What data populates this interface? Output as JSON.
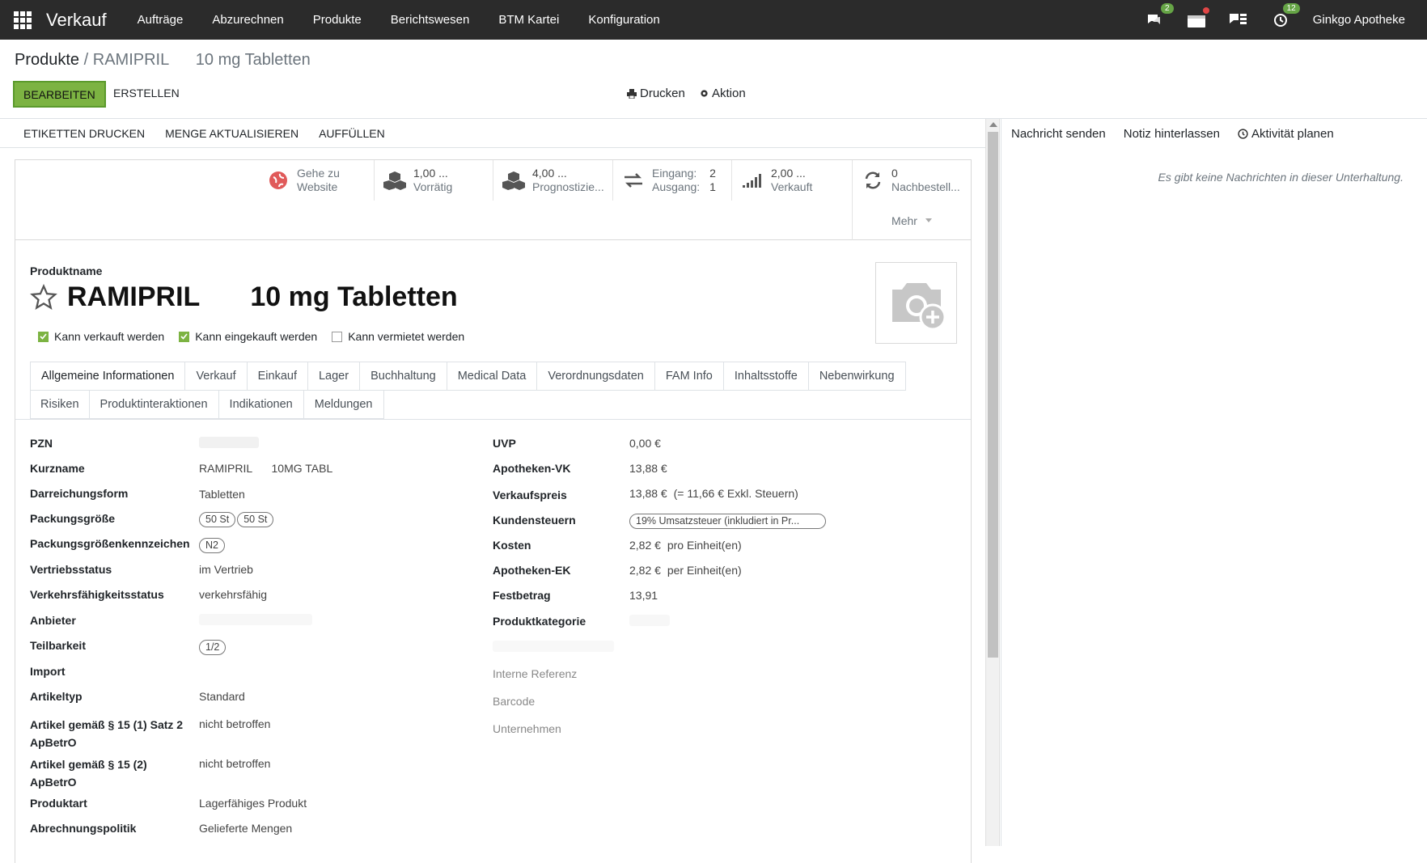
{
  "nav": {
    "app_name": "Verkauf",
    "menu": [
      "Aufträge",
      "Abzurechnen",
      "Produkte",
      "Berichtswesen",
      "BTM Kartei",
      "Konfiguration"
    ],
    "messages_badge": "2",
    "activities_badge": "12",
    "company": "Ginkgo Apotheke",
    "badge_color": "#66a546"
  },
  "breadcrumb": {
    "parent": "Produkte",
    "separator": "/",
    "current": "RAMIPRIL      10 mg Tabletten"
  },
  "controls": {
    "edit": "BEARBEITEN",
    "create": "ERSTELLEN",
    "print": "Drucken",
    "action": "Aktion"
  },
  "statusbar": [
    "ETIKETTEN DRUCKEN",
    "MENGE AKTUALISIEREN",
    "AUFFÜLLEN"
  ],
  "smart_buttons": {
    "website": {
      "line1": "Gehe zu",
      "line2": "Website"
    },
    "onhand": {
      "value": "1,00 ...",
      "label": "Vorrätig"
    },
    "forecast": {
      "value": "4,00 ...",
      "label": "Prognostizie..."
    },
    "moves": {
      "in_label": "Eingang:",
      "in_value": "2",
      "out_label": "Ausgang:",
      "out_value": "1"
    },
    "sold": {
      "value": "2,00 ...",
      "label": "Verkauft"
    },
    "reorder": {
      "value": "0",
      "label": "Nachbestell..."
    },
    "more": "Mehr"
  },
  "product": {
    "name_label": "Produktname",
    "name": "RAMIPRIL",
    "name_suffix": "10 mg Tabletten",
    "can_sell": "Kann verkauft werden",
    "can_purchase": "Kann eingekauft werden",
    "can_rent": "Kann vermietet werden"
  },
  "tabs_row1": [
    "Allgemeine Informationen",
    "Verkauf",
    "Einkauf",
    "Lager",
    "Buchhaltung",
    "Medical Data",
    "Verordnungsdaten",
    "FAM Info",
    "Inhaltsstoffe",
    "Nebenwirkung"
  ],
  "tabs_row2": [
    "Risiken",
    "Produktinteraktionen",
    "Indikationen",
    "Meldungen"
  ],
  "left_fields": {
    "pzn": "PZN",
    "kurzname": "Kurzname",
    "kurzname_val1": "RAMIPRIL",
    "kurzname_val2": "10MG TABL",
    "darreichungsform": "Darreichungsform",
    "darreichungsform_val": "Tabletten",
    "packungsgroesse": "Packungsgröße",
    "packungsgroesse_tag1": "50 St",
    "packungsgroesse_tag2": "50 St",
    "kennzeichen": "Packungsgrößenkennzeichen",
    "kennzeichen_tag": "N2",
    "vertriebsstatus": "Vertriebsstatus",
    "vertriebsstatus_val": "im Vertrieb",
    "verkehrsfaehigkeit": "Verkehrsfähigkeitsstatus",
    "verkehrsfaehigkeit_val": "verkehrsfähig",
    "anbieter": "Anbieter",
    "teilbarkeit": "Teilbarkeit",
    "teilbarkeit_tag": "1/2",
    "import": "Import",
    "artikeltyp": "Artikeltyp",
    "artikeltyp_val": "Standard",
    "art15_1_l1": "Artikel gemäß § 15 (1) Satz 2",
    "art15_1_l2": "ApBetrO",
    "art15_1_val": "nicht betroffen",
    "art15_2_l1": "Artikel gemäß § 15 (2)",
    "art15_2_l2": "ApBetrO",
    "art15_2_val": "nicht betroffen",
    "produktart": "Produktart",
    "produktart_val": "Lagerfähiges Produkt",
    "abrechnung": "Abrechnungspolitik",
    "abrechnung_val": "Gelieferte Mengen"
  },
  "right_fields": {
    "uvp": "UVP",
    "uvp_val": "0,00 €",
    "apvk": "Apotheken-VK",
    "apvk_val": "13,88 €",
    "vkpreis": "Verkaufspreis",
    "vkpreis_val": "13,88 €",
    "vkpreis_excl": "(= 11,66 € Exkl. Steuern)",
    "kundensteuern": "Kundensteuern",
    "kundensteuern_tag": "19% Umsatzsteuer (inkludiert in Pr...",
    "kosten": "Kosten",
    "kosten_val": "2,82 €",
    "kosten_unit": "pro Einheit(en)",
    "apek": "Apotheken-EK",
    "apek_val": "2,82 €",
    "apek_unit": "per Einheit(en)",
    "festbetrag": "Festbetrag",
    "festbetrag_val": "13,91",
    "kategorie": "Produktkategorie",
    "interne_ref": "Interne Referenz",
    "barcode": "Barcode",
    "unternehmen": "Unternehmen"
  },
  "chatter": {
    "send": "Nachricht senden",
    "note": "Notiz hinterlassen",
    "activity": "Aktivität planen",
    "empty": "Es gibt keine Nachrichten in dieser Unterhaltung."
  }
}
